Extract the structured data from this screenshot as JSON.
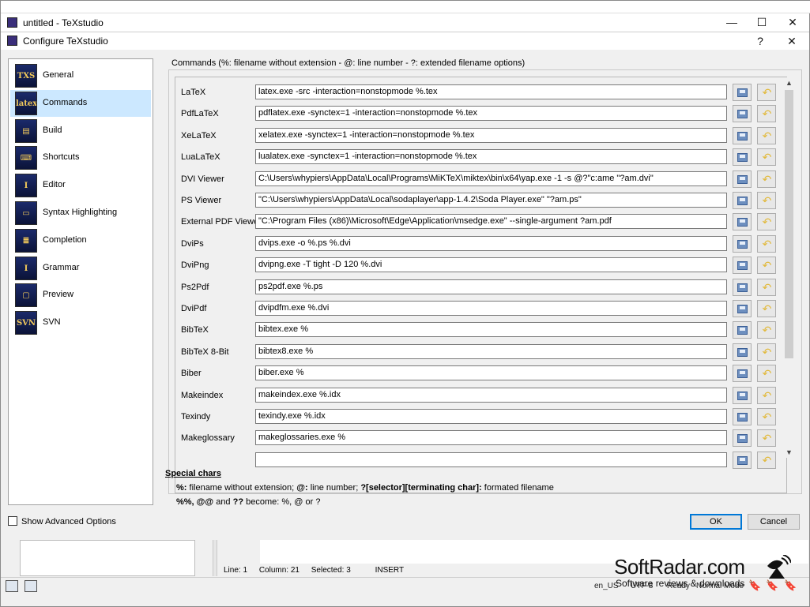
{
  "main_window": {
    "title": "untitled - TeXstudio",
    "minimize": "—",
    "maximize": "☐",
    "close": "✕"
  },
  "dialog": {
    "title": "Configure TeXstudio",
    "help": "?",
    "close": "✕"
  },
  "sidebar": {
    "items": [
      {
        "label": "General",
        "icon": "general-icon",
        "glyph": "TXS"
      },
      {
        "label": "Commands",
        "icon": "commands-icon",
        "glyph": "latex"
      },
      {
        "label": "Build",
        "icon": "build-icon",
        "glyph": "▤"
      },
      {
        "label": "Shortcuts",
        "icon": "shortcuts-icon",
        "glyph": "⌨"
      },
      {
        "label": "Editor",
        "icon": "editor-icon",
        "glyph": "I"
      },
      {
        "label": "Syntax Highlighting",
        "icon": "syntax-icon",
        "glyph": "▭"
      },
      {
        "label": "Completion",
        "icon": "completion-icon",
        "glyph": "≣"
      },
      {
        "label": "Grammar",
        "icon": "grammar-icon",
        "glyph": "I"
      },
      {
        "label": "Preview",
        "icon": "preview-icon",
        "glyph": "▢"
      },
      {
        "label": "SVN",
        "icon": "svn-icon",
        "glyph": "SVN"
      }
    ],
    "selected_index": 1
  },
  "commands": {
    "header": "Commands (%: filename without extension - @: line number - ?: extended filename options)",
    "rows": [
      {
        "label": "LaTeX",
        "value": "latex.exe -src -interaction=nonstopmode %.tex"
      },
      {
        "label": "PdfLaTeX",
        "value": "pdflatex.exe -synctex=1 -interaction=nonstopmode %.tex"
      },
      {
        "label": "XeLaTeX",
        "value": "xelatex.exe -synctex=1 -interaction=nonstopmode %.tex"
      },
      {
        "label": "LuaLaTeX",
        "value": "lualatex.exe -synctex=1 -interaction=nonstopmode %.tex"
      },
      {
        "label": "DVI Viewer",
        "value": "C:\\Users\\whypiers\\AppData\\Local\\Programs\\MiKTeX\\miktex\\bin\\x64\\yap.exe -1 -s @?\"c:ame \"?am.dvi\""
      },
      {
        "label": "PS Viewer",
        "value": "\"C:\\Users\\whypiers\\AppData\\Local\\sodaplayer\\app-1.4.2\\Soda Player.exe\" \"?am.ps\""
      },
      {
        "label": "External PDF Viewer",
        "value": "\"C:\\Program Files (x86)\\Microsoft\\Edge\\Application\\msedge.exe\" --single-argument ?am.pdf"
      },
      {
        "label": "DviPs",
        "value": "dvips.exe -o %.ps %.dvi"
      },
      {
        "label": "DviPng",
        "value": "dvipng.exe -T tight -D 120 %.dvi"
      },
      {
        "label": "Ps2Pdf",
        "value": "ps2pdf.exe %.ps"
      },
      {
        "label": "DviPdf",
        "value": "dvipdfm.exe %.dvi"
      },
      {
        "label": "BibTeX",
        "value": "bibtex.exe %"
      },
      {
        "label": "BibTeX 8-Bit",
        "value": "bibtex8.exe %"
      },
      {
        "label": "Biber",
        "value": "biber.exe %"
      },
      {
        "label": "Makeindex",
        "value": "makeindex.exe %.idx"
      },
      {
        "label": "Texindy",
        "value": "texindy.exe %.idx"
      },
      {
        "label": "Makeglossary",
        "value": "makeglossaries.exe %"
      },
      {
        "label": "",
        "value": ""
      }
    ]
  },
  "special_chars": {
    "title": "Special chars",
    "line1_a": "%:",
    "line1_b": " filename without extension; ",
    "line1_c": "@:",
    "line1_d": " line number; ",
    "line1_e": "?[selector][terminating char]:",
    "line1_f": " formated filename",
    "line2_a": "%%, @@",
    "line2_b": " and ",
    "line2_c": "??",
    "line2_d": " become: %, @ or ?"
  },
  "footer": {
    "advanced_label": "Show Advanced Options",
    "ok": "OK",
    "cancel": "Cancel"
  },
  "status": {
    "line": "Line: 1",
    "column": "Column: 21",
    "selected": "Selected: 3",
    "mode": "INSERT",
    "lang": "en_US",
    "encoding": "UTF-8",
    "state": "Ready",
    "edit_mode": "Normal Mode"
  },
  "watermark": {
    "name": "SoftRadar.com",
    "tagline": "Software reviews & downloads"
  }
}
